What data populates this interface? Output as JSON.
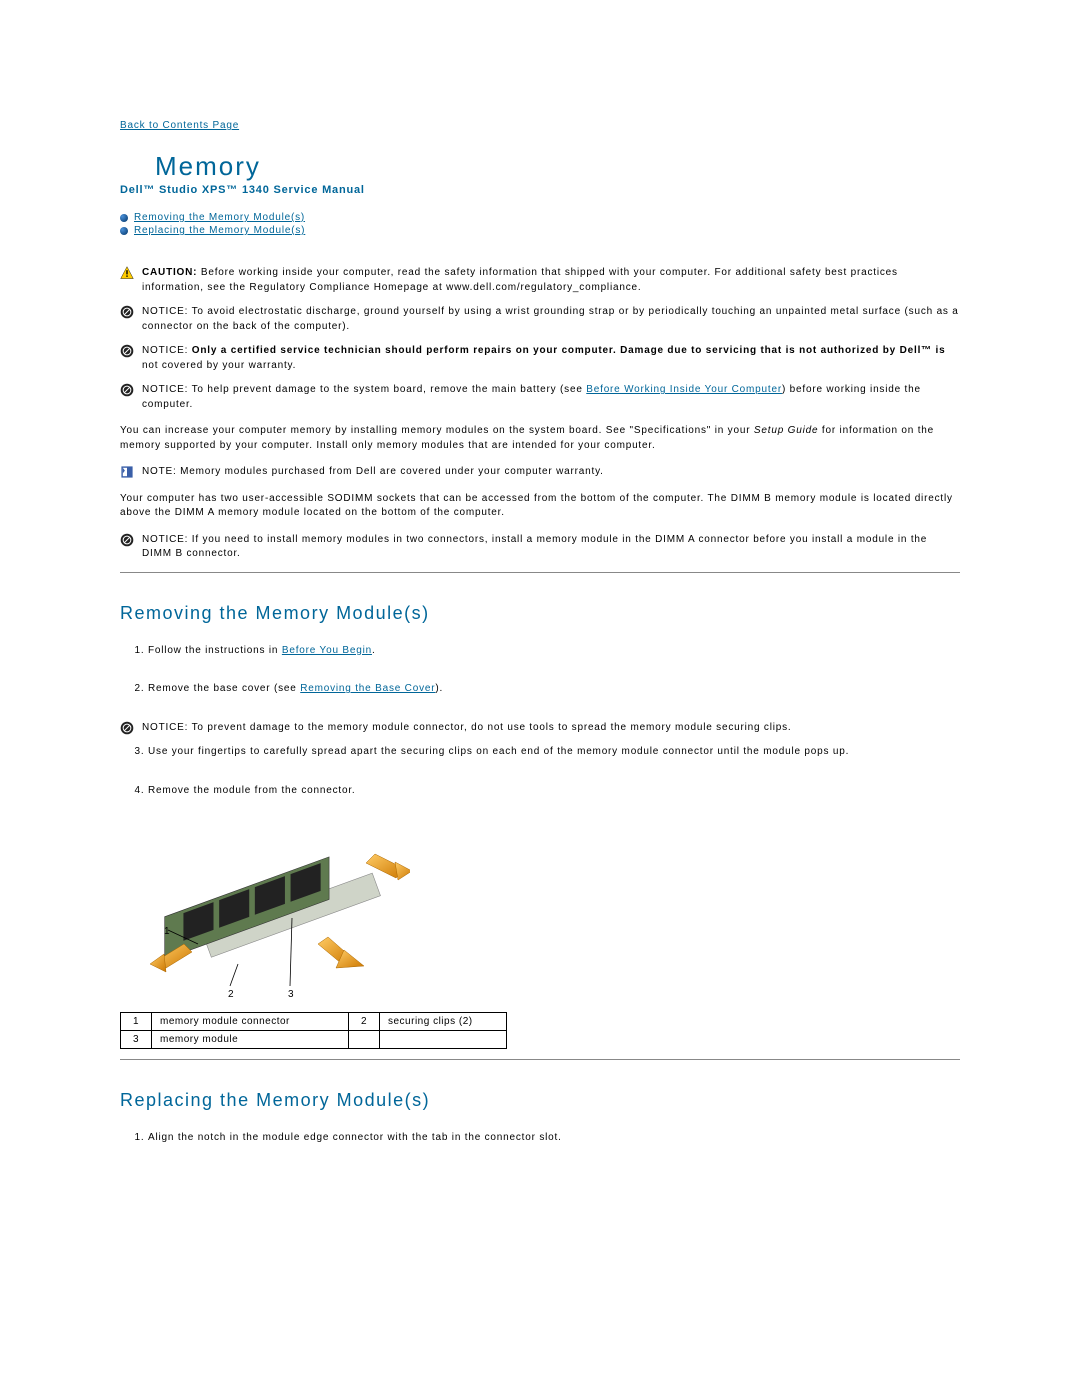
{
  "nav": {
    "back_to_contents": "Back to Contents Page"
  },
  "title": "Memory",
  "subtitle": "Dell™ Studio XPS™ 1340 Service Manual",
  "toc": {
    "item1": "Removing the Memory Module(s)",
    "item2": "Replacing the Memory Module(s)"
  },
  "caution": {
    "label": "CAUTION:",
    "text": "Before working inside your computer, read the safety information that shipped with your computer. For additional safety best practices information, see the Regulatory Compliance Homepage at www.dell.com/regulatory_compliance."
  },
  "notice1": {
    "label": "NOTICE:",
    "text": "To avoid electrostatic discharge, ground yourself by using a wrist grounding strap or by periodically touching an unpainted metal surface (such as a connector on the back of the computer)."
  },
  "notice2": {
    "label": "NOTICE:",
    "text": "Only a certified service technician should perform repairs on your computer. Damage due to servicing that is not authorized by Dell™ is",
    "text2": " not covered by your warranty."
  },
  "notice3": {
    "label": "NOTICE:",
    "text_pre": "To help prevent damage to the system board, remove the main battery (see ",
    "link": "Before Working Inside Your Computer",
    "text_post": ") before working inside the computer."
  },
  "para1_pre": "You can increase your computer memory by installing memory modules on the system board. See \"Specifications\" in your ",
  "para1_italic": "Setup Guide",
  "para1_post": " for information on the memory supported by your computer. Install only memory modules that are intended for your computer.",
  "note1": {
    "label": "NOTE:",
    "text": "Memory modules purchased from Dell are covered under your computer warranty."
  },
  "para2": "Your computer has two user-accessible SODIMM sockets that can be accessed from the bottom of the computer. The DIMM B memory module is located directly above the DIMM A memory module located on the bottom of the computer.",
  "notice4": {
    "label": "NOTICE:",
    "text": "If you need to install memory modules in two connectors, install a memory module in the DIMM A connector before you install a module in the DIMM B connector."
  },
  "section_remove": {
    "heading": "Removing the Memory Module(s)",
    "step1_pre": "Follow the instructions in ",
    "step1_link": "Before You Begin",
    "step1_post": ".",
    "step2_pre": "Remove the base cover (see ",
    "step2_link": "Removing the Base Cover",
    "step2_post": ").",
    "notice": {
      "label": "NOTICE:",
      "text": "To prevent damage to the memory module connector, do not use tools to spread the memory module securing clips."
    },
    "step3": "Use your fingertips to carefully spread apart the securing clips on each end of the memory module connector until the module pops up.",
    "step4": "Remove the module from the connector."
  },
  "callout_table": {
    "r1n": "1",
    "r1l": "memory module connector",
    "r2n": "2",
    "r2l": "securing clips (2)",
    "r3n": "3",
    "r3l": "memory module"
  },
  "diagram_labels": {
    "l1": "1",
    "l2": "2",
    "l3": "3"
  },
  "section_replace": {
    "heading": "Replacing the Memory Module(s)",
    "step1": "Align the notch in the module edge connector with the tab in the connector slot."
  }
}
